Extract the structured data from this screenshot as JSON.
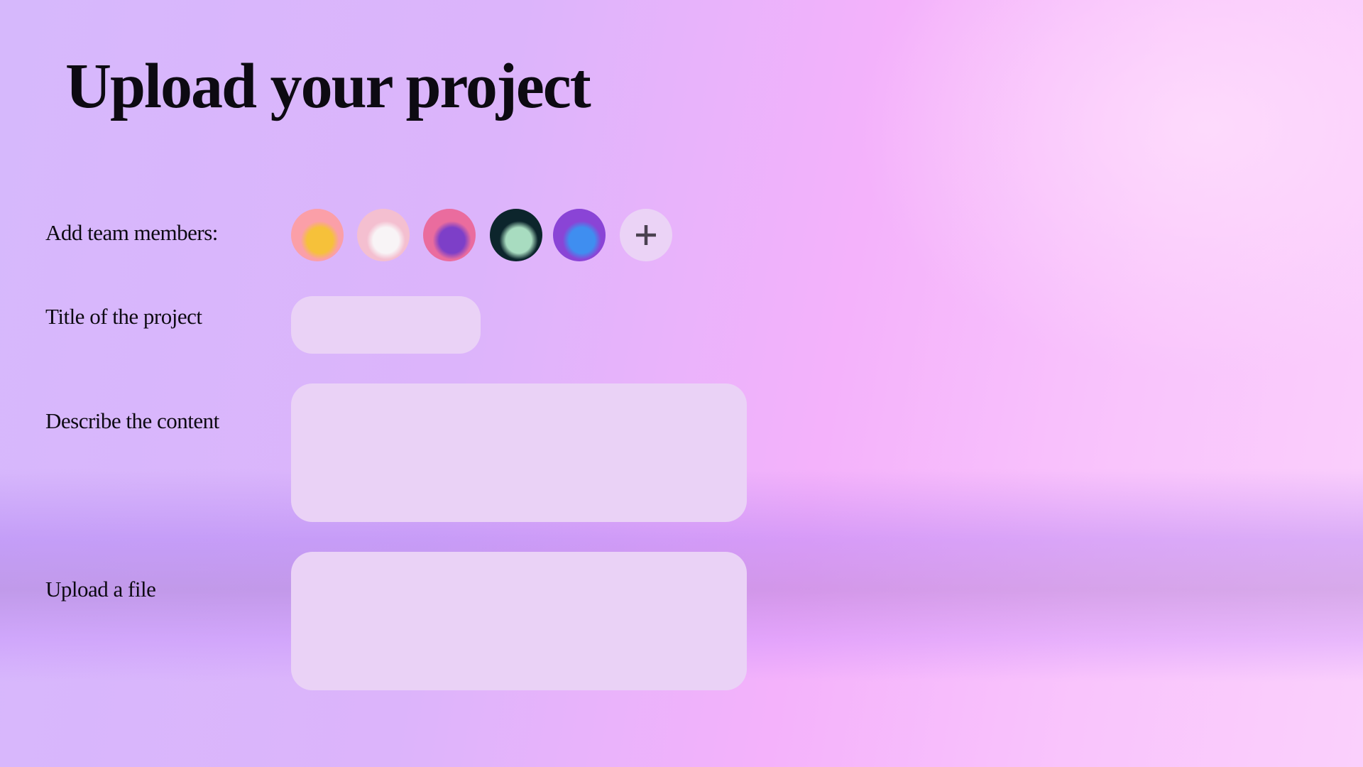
{
  "page_title": "Upload your project",
  "team": {
    "label": "Add team members:",
    "members": [
      {
        "name": "shiba-cat-avatar",
        "bg": "#fb9fa8",
        "fg": "#f6c13a"
      },
      {
        "name": "star-unicorn-avatar",
        "bg": "#f4bfd0",
        "fg": "#f8f4f6"
      },
      {
        "name": "purple-monster-avatar",
        "bg": "#ea6c9e",
        "fg": "#7d3fc8"
      },
      {
        "name": "ghost-avatar",
        "bg": "#0c252c",
        "fg": "#a8dcc0"
      },
      {
        "name": "blue-owl-avatar",
        "bg": "#8a44d6",
        "fg": "#3f8ef0"
      }
    ],
    "add_icon": "plus-icon"
  },
  "project_title": {
    "label": "Title of the project",
    "value": ""
  },
  "description": {
    "label": "Describe the content",
    "value": ""
  },
  "upload": {
    "label": "Upload a file"
  }
}
